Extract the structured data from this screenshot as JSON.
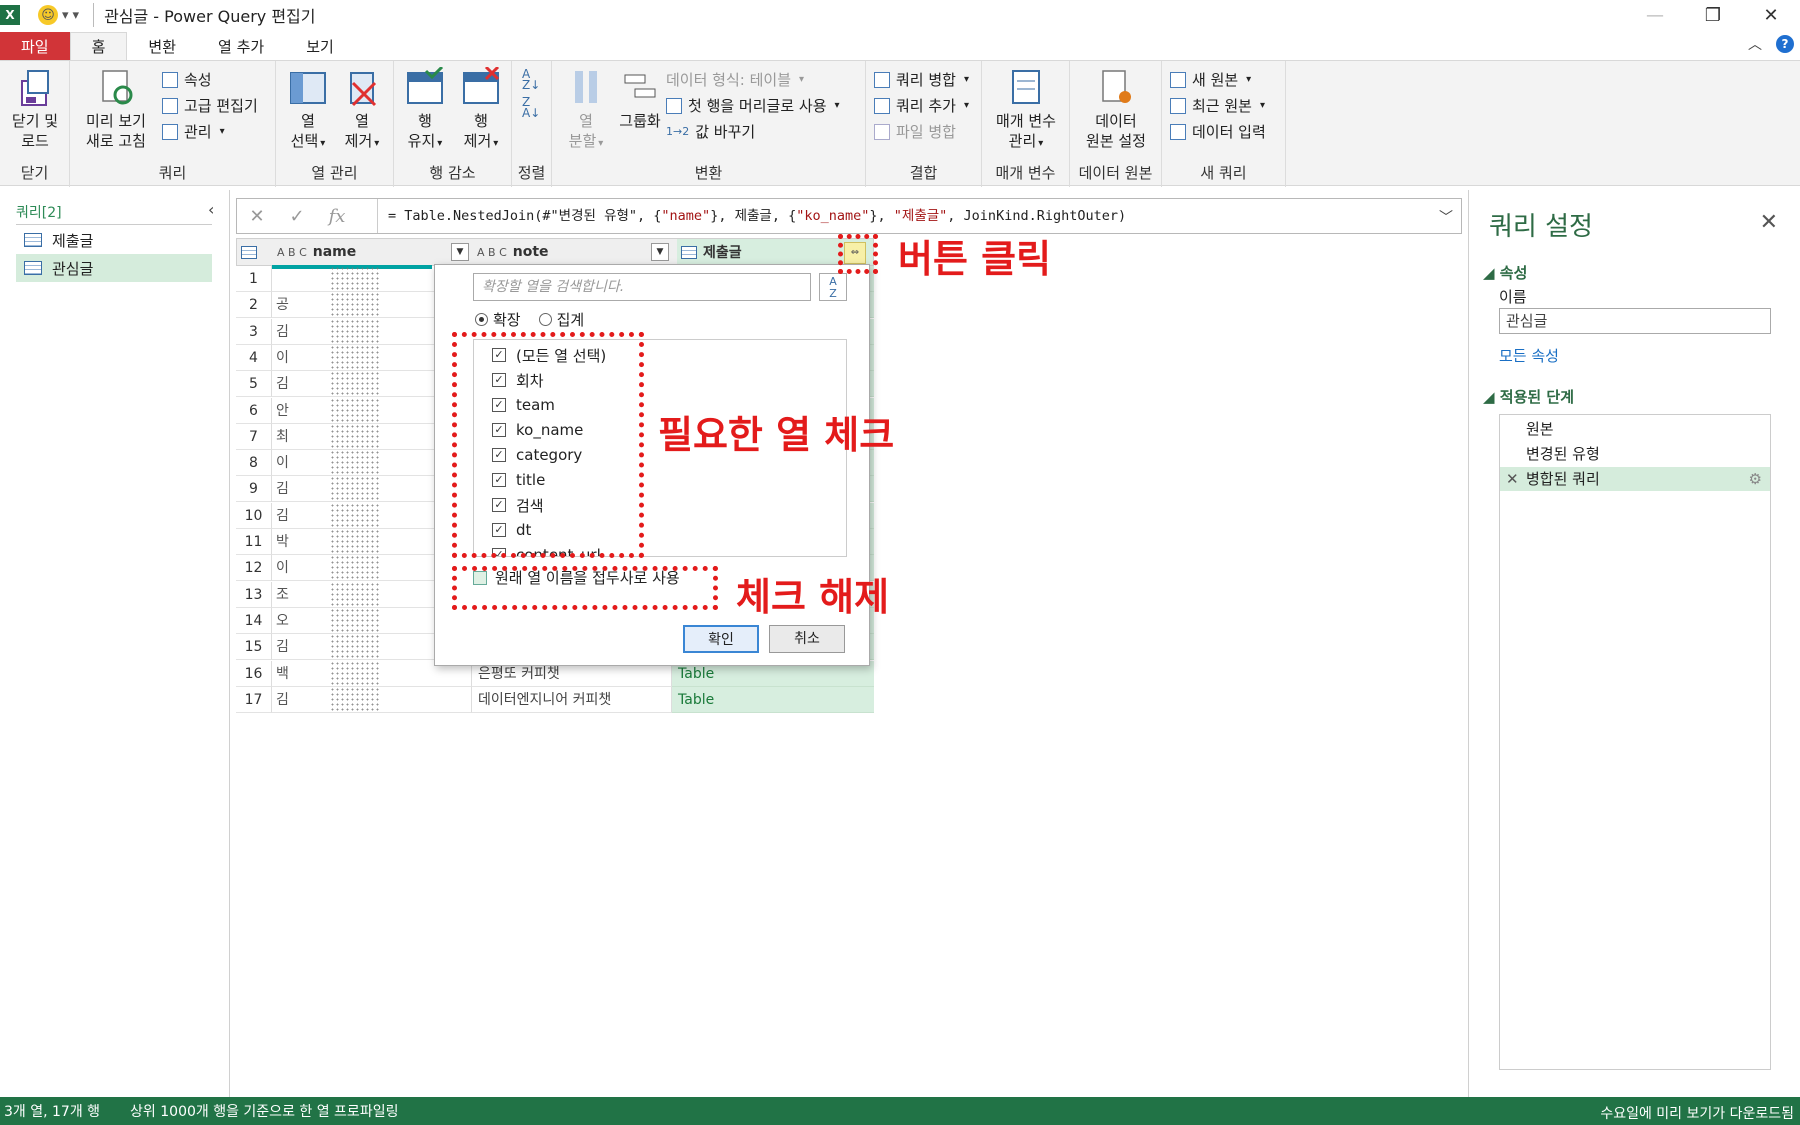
{
  "window": {
    "title": "관심글 - Power Query 편집기"
  },
  "tabs": [
    {
      "label": "파일"
    },
    {
      "label": "홈"
    },
    {
      "label": "변환"
    },
    {
      "label": "열 추가"
    },
    {
      "label": "보기"
    }
  ],
  "ribbon": {
    "close_load": "닫기 및\n로드",
    "refresh_preview": "미리 보기\n새로 고침",
    "properties": "속성",
    "advanced_editor": "고급 편집기",
    "manage": "관리",
    "choose_columns": "열\n선택",
    "remove_columns": "열\n제거",
    "keep_rows": "행\n유지",
    "remove_rows": "행\n제거",
    "split_column": "열\n분할",
    "group_by": "그룹화",
    "data_type": "데이터 형식: 테이블",
    "first_row_header": "첫 행을 머리글로 사용",
    "replace_values": "값 바꾸기",
    "merge_queries": "쿼리 병합",
    "append_queries": "쿼리 추가",
    "combine_files": "파일 병합",
    "manage_params": "매개 변수\n관리",
    "data_source_settings": "데이터\n원본 설정",
    "new_source": "새 원본",
    "recent_sources": "최근 원본",
    "enter_data": "데이터 입력",
    "groups": {
      "close": "닫기",
      "query": "쿼리",
      "manage_cols": "열 관리",
      "reduce_rows": "행 감소",
      "sort": "정렬",
      "transform": "변환",
      "combine": "결합",
      "params": "매개 변수",
      "data_source": "데이터 원본",
      "new_query": "새 쿼리"
    }
  },
  "formula": {
    "p1": "= Table.NestedJoin(#\"변경된 유형\", {",
    "s1": "\"name\"",
    "p2": "}, 제출글, {",
    "s2": "\"ko_name\"",
    "p3": "}, ",
    "s3": "\"제출글\"",
    "p4": ", JoinKind.RightOuter)"
  },
  "queries": {
    "header": "쿼리[2]",
    "items": [
      {
        "label": "제출글"
      },
      {
        "label": "관심글"
      }
    ]
  },
  "grid": {
    "col_type": "A B C",
    "columns": [
      "name",
      "note",
      "제출글"
    ],
    "rows": [
      {
        "n": "1",
        "name": "",
        "note": "",
        "tbl": ""
      },
      {
        "n": "2",
        "name": "공",
        "note": "",
        "tbl": ""
      },
      {
        "n": "3",
        "name": "김",
        "note": "",
        "tbl": ""
      },
      {
        "n": "4",
        "name": "이",
        "note": "",
        "tbl": ""
      },
      {
        "n": "5",
        "name": "김",
        "note": "",
        "tbl": ""
      },
      {
        "n": "6",
        "name": "안",
        "note": "",
        "tbl": ""
      },
      {
        "n": "7",
        "name": "최",
        "note": "",
        "tbl": ""
      },
      {
        "n": "8",
        "name": "이",
        "note": "",
        "tbl": ""
      },
      {
        "n": "9",
        "name": "김",
        "note": "",
        "tbl": ""
      },
      {
        "n": "10",
        "name": "김",
        "note": "",
        "tbl": ""
      },
      {
        "n": "11",
        "name": "박",
        "note": "",
        "tbl": ""
      },
      {
        "n": "12",
        "name": "이",
        "note": "",
        "tbl": ""
      },
      {
        "n": "13",
        "name": "조",
        "note": "",
        "tbl": ""
      },
      {
        "n": "14",
        "name": "오",
        "note": "",
        "tbl": ""
      },
      {
        "n": "15",
        "name": "김",
        "note": "",
        "tbl": ""
      },
      {
        "n": "16",
        "name": "백",
        "note": "은평또 커피챗",
        "tbl": "Table"
      },
      {
        "n": "17",
        "name": "김",
        "note": "데이터엔지니어 커피챗",
        "tbl": "Table"
      }
    ]
  },
  "popup": {
    "search_placeholder": "확장할 열을 검색합니다.",
    "expand_label": "확장",
    "aggregate_label": "집계",
    "items": [
      "(모든 열 선택)",
      "회차",
      "team",
      "ko_name",
      "category",
      "title",
      "검색",
      "dt",
      "content_url"
    ],
    "prefix_label": "원래 열 이름을 접두사로 사용",
    "ok": "확인",
    "cancel": "취소"
  },
  "annotations": {
    "click_button": "버튼 클릭",
    "check_columns": "필요한 열 체크",
    "uncheck": "체크 해제"
  },
  "settings": {
    "title": "쿼리 설정",
    "properties": "속성",
    "name_label": "이름",
    "name_value": "관심글",
    "all_properties": "모든 속성",
    "applied_steps": "적용된 단계",
    "steps": [
      "원본",
      "변경된 유형",
      "병합된 쿼리"
    ]
  },
  "status": {
    "left": "3개 열, 17개 행",
    "middle": "상위 1000개 행을 기준으로 한 열 프로파일링",
    "right": "수요일에 미리 보기가 다운로드됨"
  },
  "colors": {
    "accent": "#217346",
    "file_tab": "#d13438",
    "annotation": "#e31b1b",
    "selection": "#d5ecdc"
  }
}
